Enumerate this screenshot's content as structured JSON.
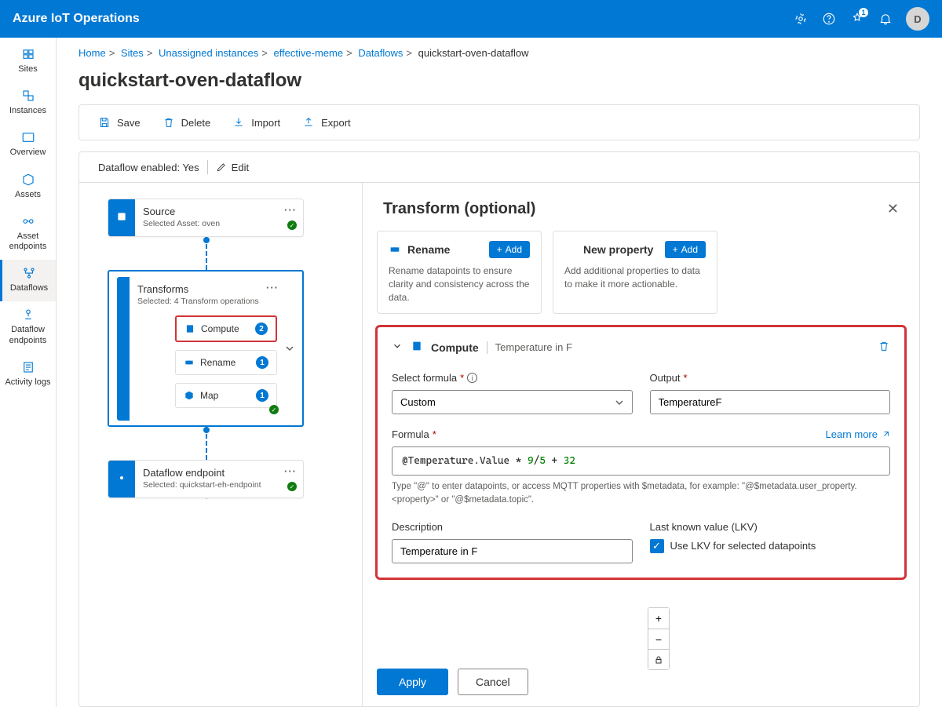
{
  "header": {
    "brand": "Azure IoT Operations",
    "notif_count": "1",
    "avatar": "D"
  },
  "rail": {
    "items": [
      {
        "label": "Sites"
      },
      {
        "label": "Instances"
      },
      {
        "label": "Overview"
      },
      {
        "label": "Assets"
      },
      {
        "label": "Asset endpoints"
      },
      {
        "label": "Dataflows"
      },
      {
        "label": "Dataflow endpoints"
      },
      {
        "label": "Activity logs"
      }
    ]
  },
  "breadcrumb": [
    {
      "label": "Home"
    },
    {
      "label": "Sites"
    },
    {
      "label": "Unassigned instances"
    },
    {
      "label": "effective-meme"
    },
    {
      "label": "Dataflows"
    },
    {
      "label": "quickstart-oven-dataflow"
    }
  ],
  "title": "quickstart-oven-dataflow",
  "toolbar": {
    "save": "Save",
    "delete": "Delete",
    "import": "Import",
    "export": "Export"
  },
  "canvas": {
    "enabled_label": "Dataflow enabled: ",
    "enabled_value": "Yes",
    "edit": "Edit"
  },
  "nodes": {
    "source": {
      "title": "Source",
      "sub": "Selected Asset: oven"
    },
    "transforms": {
      "title": "Transforms",
      "sub": "Selected: 4 Transform operations",
      "items": [
        {
          "label": "Compute",
          "count": "2",
          "hl": true
        },
        {
          "label": "Rename",
          "count": "1"
        },
        {
          "label": "Map",
          "count": "1"
        }
      ]
    },
    "endpoint": {
      "title": "Dataflow endpoint",
      "sub": "Selected: quickstart-eh-endpoint"
    }
  },
  "panel": {
    "title": "Transform (optional)",
    "rename_card": {
      "name": "Rename",
      "add": "Add",
      "desc": "Rename datapoints to ensure clarity and consistency across the data."
    },
    "newprop_card": {
      "name": "New property",
      "add": "Add",
      "desc": "Add additional properties to data to make it more actionable."
    },
    "compute": {
      "name": "Compute",
      "sub": "Temperature in F",
      "select_label": "Select formula",
      "select_value": "Custom",
      "output_label": "Output",
      "output_value": "TemperatureF",
      "formula_label": "Formula",
      "learn": "Learn more",
      "formula_prefix": "@Temperature.Value ",
      "formula_n1": "9",
      "formula_s1": "/",
      "formula_n2": "5",
      "formula_s2": " + ",
      "formula_n3": "32",
      "hint": "Type \"@\" to enter datapoints, or access MQTT properties with $metadata, for example: \"@$metadata.user_property.<property>\" or \"@$metadata.topic\".",
      "desc_label": "Description",
      "desc_value": "Temperature in F",
      "lkv_label": "Last known value (LKV)",
      "lkv_chk": "Use LKV for selected datapoints"
    },
    "apply": "Apply",
    "cancel": "Cancel"
  }
}
